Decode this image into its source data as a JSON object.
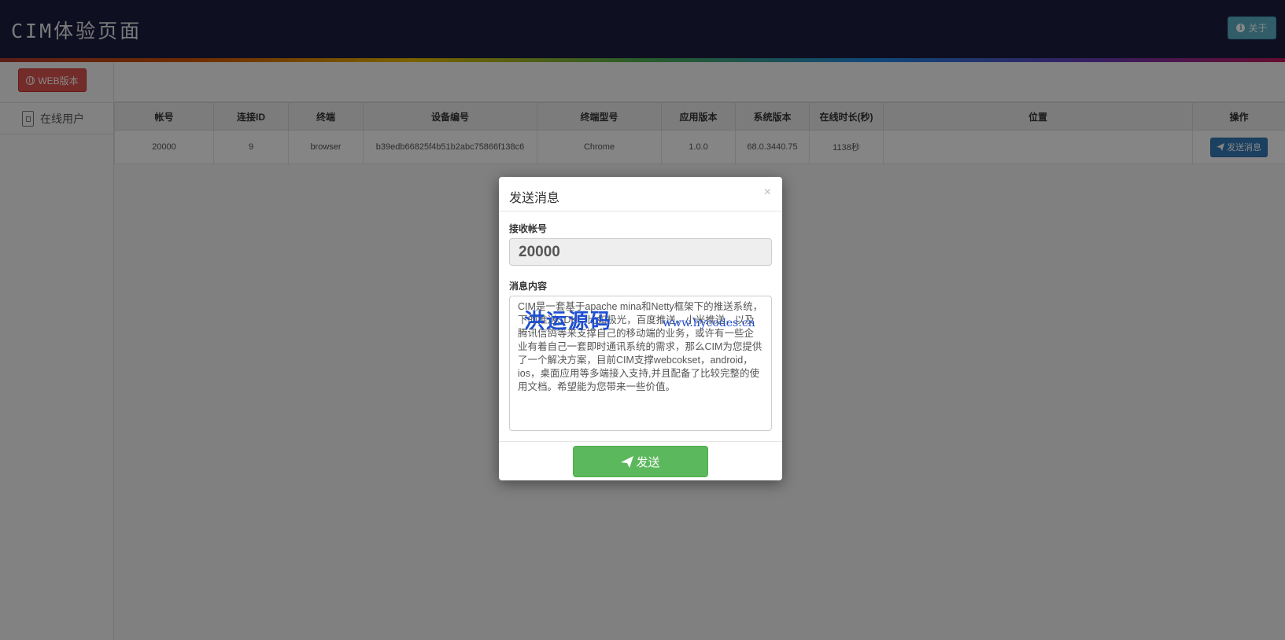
{
  "header": {
    "title": "CIM体验页面",
    "about_label": "关于"
  },
  "sidebar": {
    "web_button_label": "WEB版本",
    "items": [
      {
        "label": "在线用户"
      }
    ]
  },
  "table": {
    "columns": [
      "帐号",
      "连接ID",
      "终端",
      "设备编号",
      "终端型号",
      "应用版本",
      "系统版本",
      "在线时长(秒)",
      "位置",
      "操作"
    ],
    "rows": [
      {
        "account": "20000",
        "connection_id": "9",
        "terminal": "browser",
        "device_id": "b39edb66825f4b51b2abc75866f138c6",
        "model": "Chrome",
        "app_version": "1.0.0",
        "os_version": "68.0.3440.75",
        "online_duration": "1138秒",
        "location": "",
        "action_label": "发送消息"
      }
    ]
  },
  "modal": {
    "title": "发送消息",
    "close_symbol": "×",
    "receiver_label": "接收帐号",
    "receiver_value": "20000",
    "content_label": "消息内容",
    "content_text": "CIM是一套基于apache mina和Netty框架下的推送系统，下的推送SDK，比如极光，百度推送，小米推送，以及腾讯信鸽等来支撑自己的移动端的业务，或许有一些企业有着自己一套即时通讯系统的需求，那么CIM为您提供了一个解决方案，目前CIM支撑webcokset，android，ios，桌面应用等多端接入支持,并且配备了比较完整的使用文档。希望能为您带来一些价值。",
    "send_label": "发送"
  },
  "watermark": {
    "text": "洪运源码",
    "url": "www.hycodes.cn"
  },
  "colors": {
    "header_bg": "#1c1d3f",
    "web_button": "#d9534f",
    "about_button": "#5bb0c4",
    "primary": "#337ab7",
    "success": "#5cb85c"
  }
}
